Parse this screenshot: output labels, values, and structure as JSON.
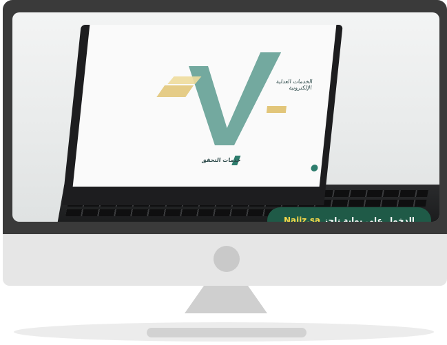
{
  "video": {
    "banner_text": "الدخول على بوابة ناجز",
    "banner_site": "Najiz.sa"
  },
  "laptop_site": {
    "hero_title": "الخدمات العدلية الإلكترونية",
    "section_title": "خدمات التحقق"
  },
  "colors": {
    "frame": "#3a3a3a",
    "brand_green": "#1f5a47",
    "accent_yellow": "#f5d74a"
  }
}
